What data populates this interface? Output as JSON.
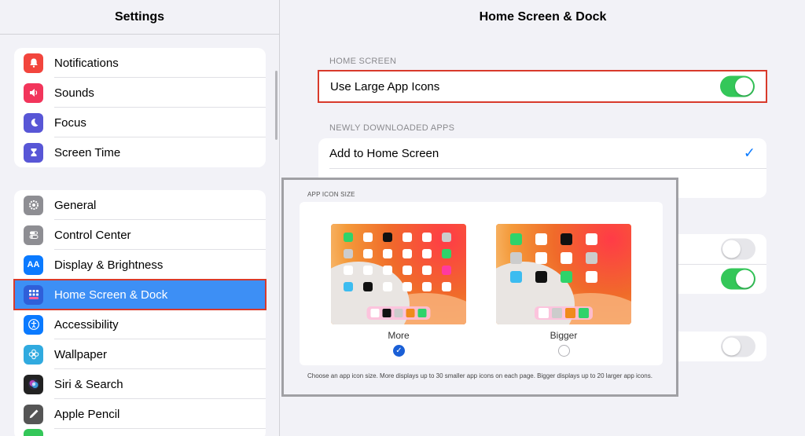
{
  "sidebar": {
    "title": "Settings",
    "groups": [
      {
        "items": [
          {
            "label": "Notifications",
            "icon": "bell-icon",
            "color": "#f2453d"
          },
          {
            "label": "Sounds",
            "icon": "speaker-icon",
            "color": "#f2355b"
          },
          {
            "label": "Focus",
            "icon": "moon-icon",
            "color": "#5856d6"
          },
          {
            "label": "Screen Time",
            "icon": "hourglass-icon",
            "color": "#5856d6"
          }
        ]
      },
      {
        "items": [
          {
            "label": "General",
            "icon": "gear-icon",
            "color": "#8e8e93"
          },
          {
            "label": "Control Center",
            "icon": "toggles-icon",
            "color": "#8e8e93"
          },
          {
            "label": "Display & Brightness",
            "icon": "text-size-icon",
            "color": "#0a7aff"
          },
          {
            "label": "Home Screen & Dock",
            "icon": "app-grid-icon",
            "color": "#2f5fd9",
            "selected": true
          },
          {
            "label": "Accessibility",
            "icon": "accessibility-icon",
            "color": "#0a7aff"
          },
          {
            "label": "Wallpaper",
            "icon": "flower-icon",
            "color": "#30aadf"
          },
          {
            "label": "Siri & Search",
            "icon": "siri-icon",
            "color": "#222222"
          },
          {
            "label": "Apple Pencil",
            "icon": "pencil-icon",
            "color": "#555555"
          }
        ]
      }
    ]
  },
  "main": {
    "title": "Home Screen & Dock",
    "home_screen": {
      "section_label": "HOME SCREEN",
      "large_icons_label": "Use Large App Icons",
      "large_icons_on": true
    },
    "downloads": {
      "section_label": "NEWLY DOWNLOADED APPS",
      "add_home_label": "Add to Home Screen",
      "add_home_checked": true
    },
    "toggles": [
      {
        "on": false
      },
      {
        "on": true
      },
      {
        "on": false
      }
    ]
  },
  "panel": {
    "label": "APP ICON SIZE",
    "options": [
      {
        "label": "More",
        "selected": true
      },
      {
        "label": "Bigger",
        "selected": false
      }
    ],
    "description": "Choose an app icon size. More displays up to 30 smaller app icons on each page. Bigger displays up to 20 larger app icons."
  },
  "colors": {
    "selected_row": "#3d8ff5",
    "highlight_border": "#d83a2b",
    "toggle_on": "#34c759",
    "check": "#0a7aff"
  }
}
